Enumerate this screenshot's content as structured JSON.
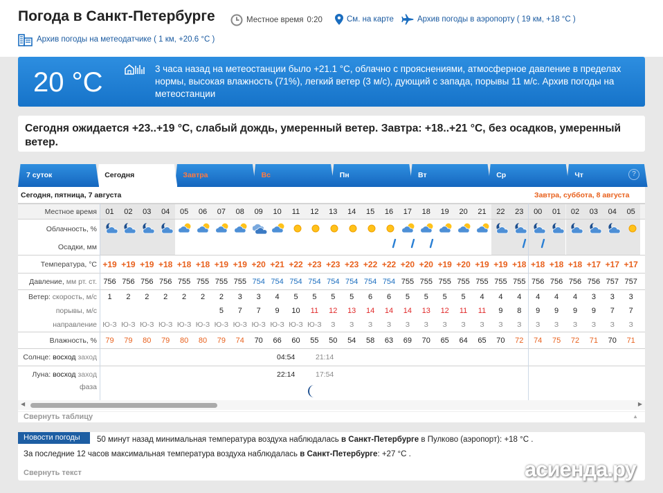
{
  "header": {
    "title": "Погода в Санкт-Петербурге",
    "local_time_label": "Местное время",
    "local_time": "0:20",
    "map_link": "См. на карте",
    "airport_archive": "Архив погоды в аэропорту ( 19 км, +18 °C )",
    "station_archive": "Архив погоды на метеодатчике ( 1 км, +20.6 °C )"
  },
  "current": {
    "temp": "20 °C",
    "description": "3 часа назад на метеостанции было +21.1 °C, облачно с прояснениями, атмосферное давление в пределах нормы, высокая влажность (71%), легкий ветер (3 м/с), дующий с запада, порывы 11 м/с. Архив погоды на метеостанции"
  },
  "forecast_text": "Сегодня ожидается +23..+19 °C, слабый дождь, умеренный ветер. Завтра: +18..+21 °C, без осадков, умеренный ветер.",
  "tabs": [
    {
      "label": "7 суток",
      "red": false,
      "active": false
    },
    {
      "label": "Сегодня",
      "red": false,
      "active": true
    },
    {
      "label": "Завтра",
      "red": true,
      "active": false
    },
    {
      "label": "Вс",
      "red": true,
      "active": false
    },
    {
      "label": "Пн",
      "red": false,
      "active": false
    },
    {
      "label": "Вт",
      "red": false,
      "active": false
    },
    {
      "label": "Ср",
      "red": false,
      "active": false
    },
    {
      "label": "Чт",
      "red": false,
      "active": false
    }
  ],
  "help_glyph": "?",
  "table": {
    "today_label": "Сегодня, пятница, 7 августа",
    "tomorrow_label": "Завтра, суббота, 8 августа",
    "labels": {
      "local_time": "Местное время",
      "cloud": "Облачность, %",
      "precip": "Осадки, мм",
      "temp": "Температура, °C",
      "pressure_a": "Давление,",
      "pressure_b": " мм рт. ст.",
      "wind_a": "Ветер:",
      "wind_b": " скорость, м/с",
      "gusts": "порывы, м/с",
      "direction": "направление",
      "humidity": "Влажность, %",
      "sun_a": "Солнце:",
      "sun_b": " восход",
      "sun_c": " заход",
      "moon_a": "Луна:",
      "moon_b": " восход",
      "moon_c": " заход",
      "phase": "фаза"
    },
    "hours": [
      "01",
      "02",
      "03",
      "04",
      "05",
      "06",
      "07",
      "08",
      "09",
      "10",
      "11",
      "12",
      "13",
      "14",
      "15",
      "16",
      "17",
      "18",
      "19",
      "20",
      "21",
      "22",
      "23",
      "00",
      "01",
      "02",
      "03",
      "04",
      "05"
    ],
    "night": [
      1,
      1,
      1,
      1,
      0,
      0,
      0,
      0,
      0,
      0,
      0,
      0,
      0,
      0,
      0,
      0,
      0,
      0,
      0,
      0,
      0,
      1,
      1,
      1,
      1,
      1,
      1,
      1,
      1
    ],
    "cloud_icons": [
      "moon-cloud",
      "moon-cloud",
      "moon-cloud",
      "moon-cloud",
      "sun-cloud",
      "sun-cloud",
      "sun-cloud",
      "sun-cloud",
      "overcast",
      "sun-cloud",
      "sun",
      "sun",
      "sun",
      "sun",
      "sun",
      "sun",
      "sun-cloud",
      "sun-cloud",
      "sun-cloud",
      "sun-cloud",
      "sun-cloud",
      "moon-cloud",
      "moon-cloud",
      "moon-cloud",
      "moon-cloud",
      "moon-cloud",
      "moon-cloud",
      "moon-cloud",
      "sun"
    ],
    "rain": [
      0,
      0,
      0,
      0,
      0,
      0,
      0,
      0,
      0,
      0,
      0,
      0,
      0,
      0,
      0,
      1,
      1,
      1,
      0,
      0,
      0,
      0,
      1,
      1,
      0,
      0,
      0,
      0,
      0
    ],
    "temps": [
      "+19",
      "+19",
      "+19",
      "+18",
      "+18",
      "+18",
      "+19",
      "+19",
      "+20",
      "+21",
      "+22",
      "+23",
      "+23",
      "+23",
      "+22",
      "+22",
      "+20",
      "+20",
      "+19",
      "+20",
      "+19",
      "+19",
      "+18",
      "+18",
      "+18",
      "+18",
      "+17",
      "+17",
      "+17"
    ],
    "pressure": [
      "756",
      "756",
      "756",
      "756",
      "755",
      "755",
      "755",
      "755",
      "754",
      "754",
      "754",
      "754",
      "754",
      "754",
      "754",
      "754",
      "755",
      "755",
      "755",
      "755",
      "755",
      "755",
      "755",
      "756",
      "756",
      "756",
      "756",
      "757",
      "757"
    ],
    "pressure_low": [
      0,
      0,
      0,
      0,
      0,
      0,
      0,
      0,
      1,
      1,
      1,
      1,
      1,
      1,
      1,
      1,
      0,
      0,
      0,
      0,
      0,
      0,
      0,
      0,
      0,
      0,
      0,
      0,
      0
    ],
    "wind": [
      "1",
      "2",
      "2",
      "2",
      "2",
      "2",
      "2",
      "3",
      "3",
      "4",
      "5",
      "5",
      "5",
      "5",
      "6",
      "6",
      "5",
      "5",
      "5",
      "5",
      "4",
      "4",
      "4",
      "4",
      "4",
      "4",
      "3",
      "3",
      "3"
    ],
    "gusts": [
      "",
      "",
      "",
      "",
      "",
      "",
      "5",
      "7",
      "7",
      "9",
      "10",
      "11",
      "12",
      "13",
      "14",
      "14",
      "14",
      "13",
      "12",
      "11",
      "11",
      "9",
      "8",
      "9",
      "9",
      "9",
      "9",
      "7",
      "7"
    ],
    "gusts_red": [
      0,
      0,
      0,
      0,
      0,
      0,
      0,
      0,
      0,
      0,
      0,
      1,
      1,
      1,
      1,
      1,
      1,
      1,
      1,
      1,
      1,
      0,
      0,
      0,
      0,
      0,
      0,
      0,
      0
    ],
    "direction": [
      "Ю-З",
      "Ю-З",
      "Ю-З",
      "Ю-З",
      "Ю-З",
      "Ю-З",
      "Ю-З",
      "Ю-З",
      "Ю-З",
      "Ю-З",
      "Ю-З",
      "Ю-З",
      "З",
      "З",
      "З",
      "З",
      "З",
      "З",
      "З",
      "З",
      "З",
      "З",
      "З",
      "З",
      "З",
      "З",
      "З",
      "З",
      "З"
    ],
    "humidity": [
      "79",
      "79",
      "80",
      "79",
      "80",
      "80",
      "79",
      "74",
      "70",
      "66",
      "60",
      "55",
      "50",
      "54",
      "58",
      "63",
      "69",
      "70",
      "65",
      "64",
      "65",
      "70",
      "72",
      "74",
      "75",
      "72",
      "71",
      "70",
      "71"
    ],
    "humidity_color": [
      "o",
      "o",
      "o",
      "o",
      "o",
      "o",
      "o",
      "o",
      "k",
      "k",
      "k",
      "k",
      "k",
      "k",
      "k",
      "k",
      "k",
      "k",
      "k",
      "k",
      "k",
      "k",
      "o",
      "o",
      "o",
      "o",
      "o",
      "k",
      "o"
    ],
    "sunrise": "04:54",
    "sunset": "21:14",
    "moonrise": "22:14",
    "moonset": "17:54",
    "collapse": "Свернуть таблицу",
    "collapse_arrow": "▲",
    "scroll_left": "◀",
    "scroll_right": "▶"
  },
  "news": {
    "label": "Новости погоды",
    "line1_pre": "50 минут назад минимальная температура воздуха наблюдалась ",
    "line1_bold": "в Санкт-Петербурге",
    "line1_post": " в Пулково (аэропорт): +18 °C .",
    "line2_pre": "За последние 12 часов максимальная температура воздуха наблюдалась ",
    "line2_bold": "в Санкт-Петербурге",
    "line2_post": ": +27 °C .",
    "collapse": "Свернуть текст"
  },
  "watermark": "асиенда.ру",
  "colors": {
    "orange": "#e8601c",
    "red": "#e02828",
    "blue": "#1a6dbf",
    "dark": "#222222"
  }
}
